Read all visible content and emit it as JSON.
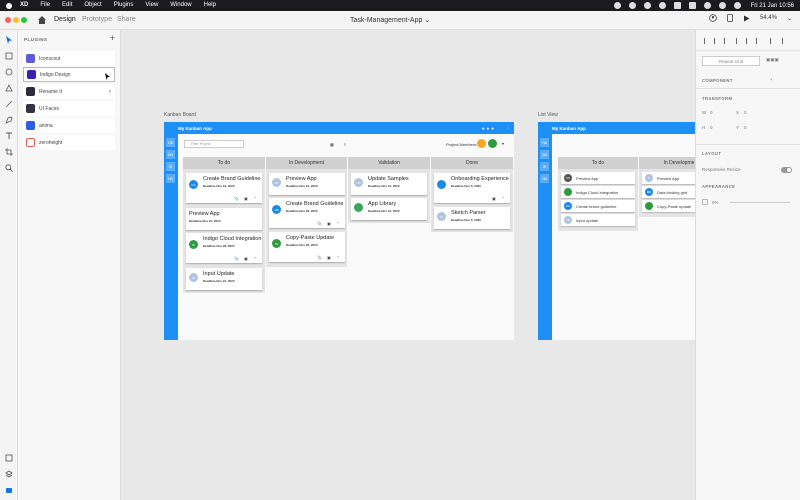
{
  "menubar": {
    "app": "XD",
    "items": [
      "File",
      "Edit",
      "Object",
      "Plugins",
      "View",
      "Window",
      "Help"
    ],
    "clock": "Fri 21 Jan 10:56"
  },
  "titlebar": {
    "tabs": [
      "Design",
      "Prototype",
      "Share"
    ],
    "active_tab": "Design",
    "document": "Task-Management-App ⌄",
    "zoom": "54.4%"
  },
  "plugins_panel": {
    "header": "PLUGINS",
    "items": [
      {
        "label": "Iconscout",
        "color": "#5b5bd6"
      },
      {
        "label": "Indigo Design",
        "color": "#3b1fb8"
      },
      {
        "label": "Rename It",
        "color": "#2a2a3a"
      },
      {
        "label": "UI Faces",
        "color": "#333344"
      },
      {
        "label": "anima",
        "color": "#2d5be3"
      },
      {
        "label": "zeroheight",
        "color": "#f05a5a"
      }
    ]
  },
  "kanban": {
    "label": "Kanban Board",
    "app_title": "My Kanban App",
    "filter_placeholder": "Filter Project",
    "project_members_label": "Project Members:",
    "columns": [
      {
        "title": "To do",
        "cards": [
          {
            "title": "Create Brand Guideline",
            "deadline": "Deadline Nov 19, 2020",
            "initials": "CA",
            "color": "#1e88e5"
          },
          {
            "title": "Preview App",
            "deadline": "Deadline Nov 21, 2020",
            "initials": "",
            "color": ""
          },
          {
            "title": "Indigo Cloud Integration",
            "deadline": "Deadline Nov 28, 2020",
            "initials": "IK",
            "color": "#2e9b3e"
          },
          {
            "title": "Input Update",
            "deadline": "Deadline Nov 21, 2020",
            "initials": "IU",
            "color": "#b0c4de"
          }
        ]
      },
      {
        "title": "In Development",
        "cards": [
          {
            "title": "Preview App",
            "deadline": "Deadline Nov 21, 2020",
            "initials": "PA",
            "color": "#b0c4de"
          },
          {
            "title": "Create Brand Guideline",
            "deadline": "Deadline Nov 29, 2020",
            "initials": "VB",
            "color": "#1e88e5"
          },
          {
            "title": "Copy-Paste Update",
            "deadline": "Deadline Nov 29, 2020",
            "initials": "IN",
            "color": "#2e9b3e"
          }
        ]
      },
      {
        "title": "Validation",
        "cards": [
          {
            "title": "Update Samples",
            "deadline": "Deadline Nov 15, 2020",
            "initials": "CP",
            "color": "#b0c4de"
          },
          {
            "title": "App Library",
            "deadline": "Deadline Nov 16, 2020",
            "initials": "",
            "color": "#3ba55c"
          }
        ]
      },
      {
        "title": "Done",
        "cards": [
          {
            "title": "Onboarding Experience",
            "deadline": "Deadline Nov 6, 2020",
            "initials": "",
            "color": "#1e88e5"
          },
          {
            "title": "Sketch Parser",
            "deadline": "Deadline Nov 5, 2020",
            "initials": "SA",
            "color": "#b0c4de"
          }
        ]
      }
    ]
  },
  "listview": {
    "label": "List View",
    "app_title": "My Kanban App",
    "columns": [
      {
        "title": "To do",
        "items": [
          {
            "title": "Preview App",
            "initials": "KS",
            "color": "#555"
          },
          {
            "title": "Indigo Cloud integration",
            "initials": "",
            "color": "#2e9b3e"
          },
          {
            "title": "Create brand guideline",
            "initials": "CA",
            "color": "#1e88e5"
          },
          {
            "title": "Input update",
            "initials": "TB",
            "color": "#b0c4de"
          }
        ]
      },
      {
        "title": "In Developme",
        "items": [
          {
            "title": "Preview App",
            "initials": "S",
            "color": "#b0c4de"
          },
          {
            "title": "Data binding grid",
            "initials": "MB",
            "color": "#1e88e5"
          },
          {
            "title": "Copy-Paste update",
            "initials": "",
            "color": "#2e9b3e"
          }
        ]
      }
    ]
  },
  "inspector": {
    "repeat_grid": "Repeat Grid",
    "component": "COMPONENT",
    "transform": "TRANSFORM",
    "w_label": "W",
    "w_value": "0",
    "x_label": "X",
    "x_value": "0",
    "h_label": "H",
    "h_value": "0",
    "y_label": "Y",
    "y_value": "0",
    "layout": "LAYOUT",
    "responsive_resize": "Responsive Resize",
    "appearance": "APPEARANCE",
    "opacity": "0%"
  }
}
